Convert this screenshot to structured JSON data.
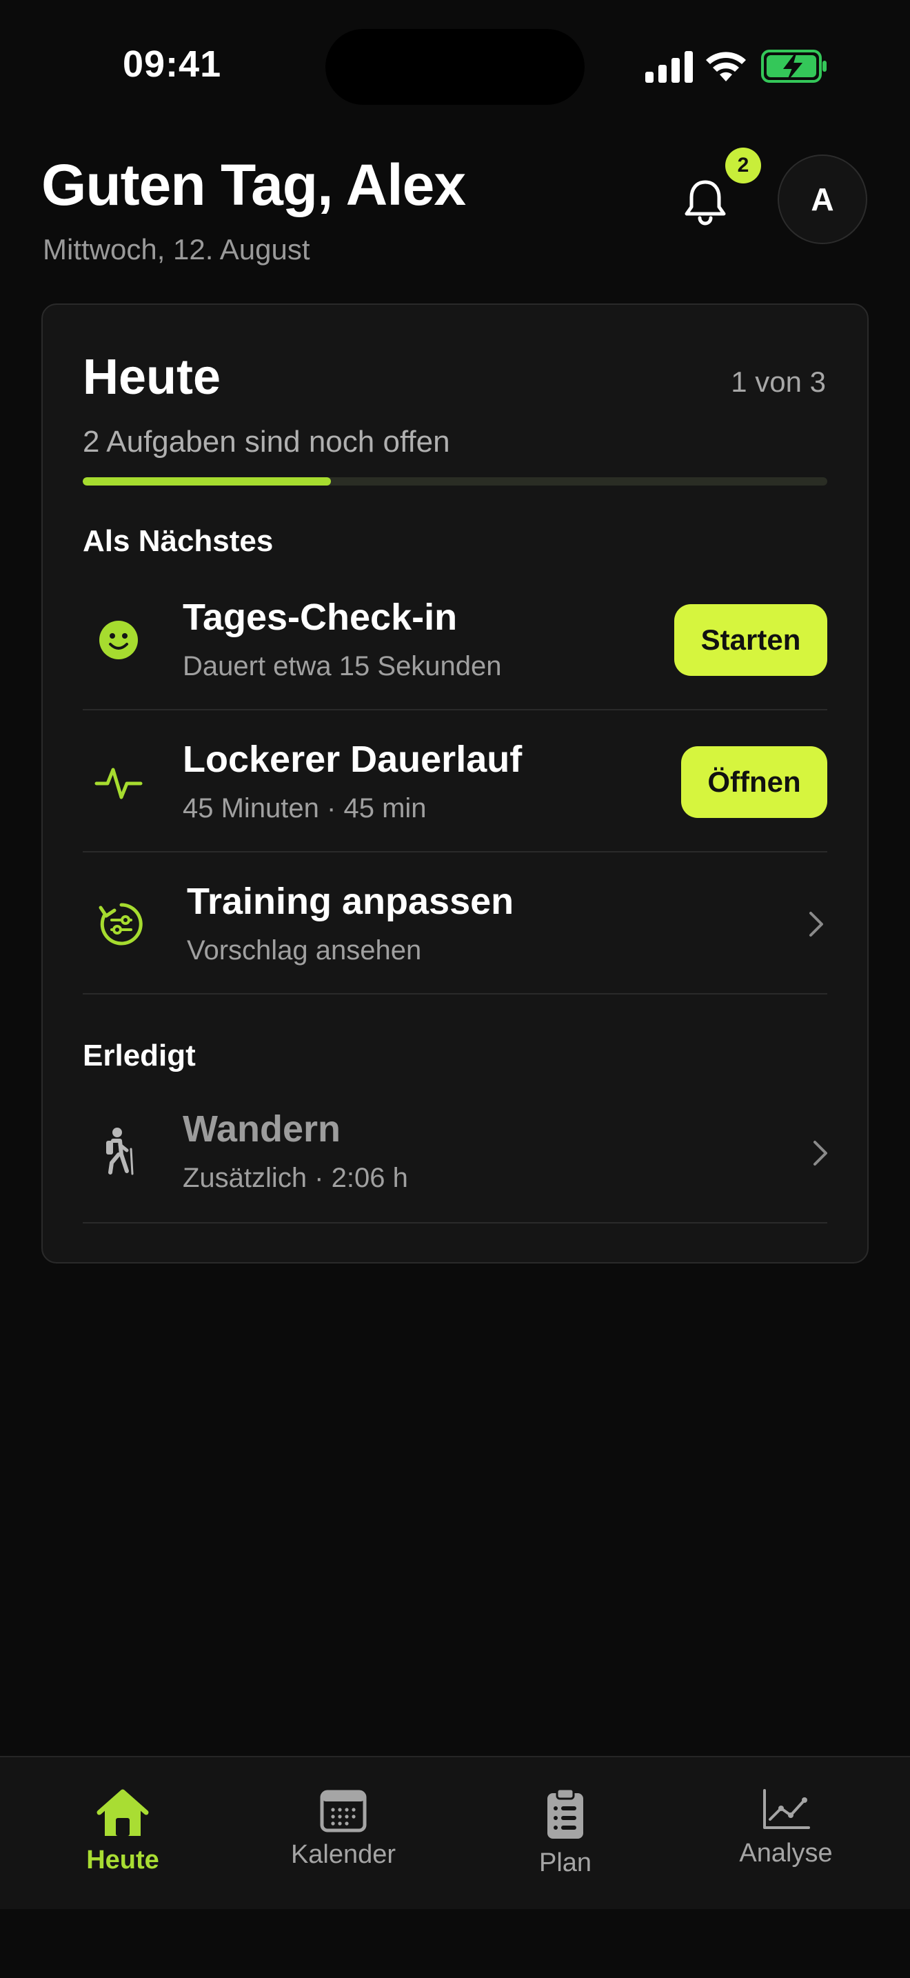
{
  "status_bar": {
    "time": "09:41"
  },
  "header": {
    "greeting": "Guten Tag, Alex",
    "date": "Mittwoch, 12. August",
    "notification_count": "2",
    "avatar_initial": "A"
  },
  "today": {
    "title": "Heute",
    "counter": "1 von 3",
    "subtitle": "2 Aufgaben sind noch offen",
    "progress": 0.333,
    "section_next": "Als Nächstes",
    "tasks": [
      {
        "title": "Tages-Check-in",
        "subtitle": "Dauert etwa 15 Sekunden",
        "action": "Starten",
        "icon": "smiley-icon"
      },
      {
        "title": "Lockerer Dauerlauf",
        "subtitle": "45 Minuten · 45 min",
        "action": "Öffnen",
        "icon": "pulse-icon"
      },
      {
        "title": "Training anpassen",
        "subtitle": "Vorschlag ansehen",
        "icon": "adjust-cycle-icon"
      }
    ],
    "section_done": "Erledigt",
    "done": [
      {
        "title": "Wandern",
        "subtitle": "Zusätzlich · 2:06 h",
        "icon": "hiker-icon"
      }
    ]
  },
  "tabs": [
    {
      "label": "Heute",
      "icon": "home-icon",
      "active": true
    },
    {
      "label": "Kalender",
      "icon": "calendar-icon",
      "active": false
    },
    {
      "label": "Plan",
      "icon": "clipboard-icon",
      "active": false
    },
    {
      "label": "Analyse",
      "icon": "chart-icon",
      "active": false
    }
  ],
  "colors": {
    "accent": "#d6f53e",
    "accent_green": "#a6dc2f",
    "background": "#0b0b0b",
    "card": "#151515"
  }
}
